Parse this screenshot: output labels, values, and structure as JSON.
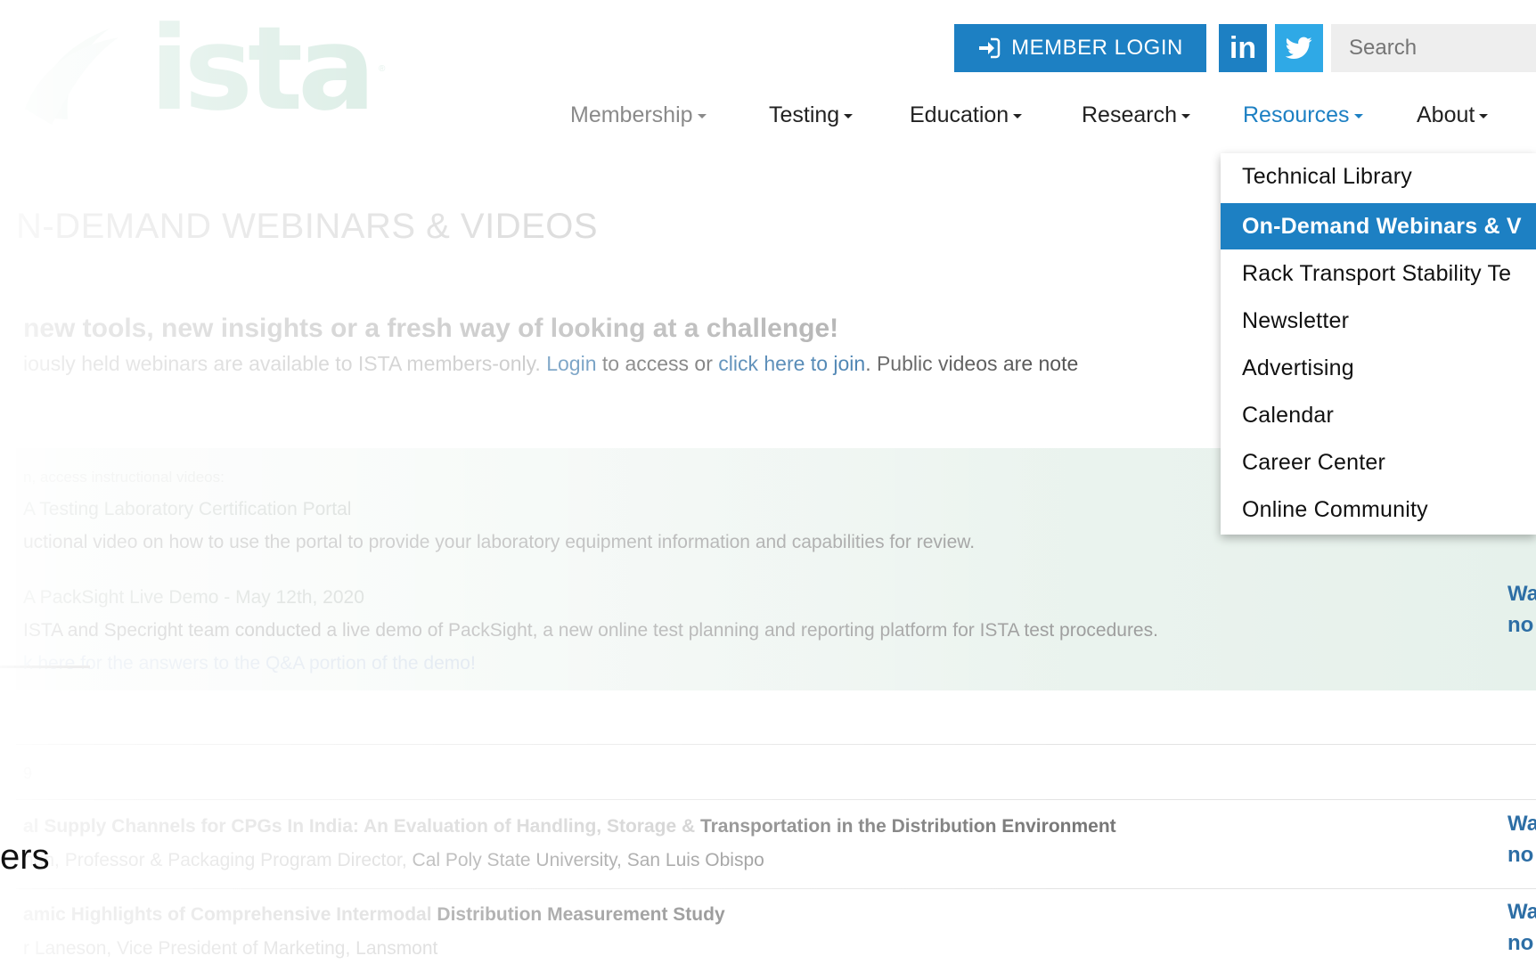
{
  "logo": {
    "text": "ista",
    "mark": "®"
  },
  "header": {
    "login_label": "MEMBER LOGIN",
    "login_icon": "sign-in-icon",
    "linkedin_label": "in",
    "twitter_icon": "twitter-bird-icon",
    "search_placeholder": "Search"
  },
  "nav": {
    "items": [
      {
        "label": "Membership"
      },
      {
        "label": "Testing"
      },
      {
        "label": "Education"
      },
      {
        "label": "Research"
      },
      {
        "label": "Resources"
      },
      {
        "label": "About"
      }
    ]
  },
  "dropdown": {
    "items": [
      {
        "label": "Technical Library"
      },
      {
        "label": "On-Demand Webinars & V"
      },
      {
        "label": "Rack Transport Stability Te"
      },
      {
        "label": "Newsletter"
      },
      {
        "label": "Advertising"
      },
      {
        "label": "Calendar"
      },
      {
        "label": "Career Center"
      },
      {
        "label": "Online Community"
      }
    ]
  },
  "page": {
    "title": "N-DEMAND WEBINARS & VIDEOS",
    "tagline": "new tools, new insights or a fresh way of looking at a challenge!",
    "intro_pre": "iously held webinars are available to ISTA members-only. ",
    "intro_login": "Login",
    "intro_mid": " to access or ",
    "intro_join": "click here to join",
    "intro_post": ". Public videos are note"
  },
  "instructional": {
    "label": "n, access instructional videos:",
    "items": [
      {
        "title": "A Testing Laboratory Certification Portal",
        "desc": "uctional video on how to use the portal to provide your laboratory equipment information and capabilities for review."
      },
      {
        "title": "A PackSight Live Demo - May 12th, 2020",
        "desc": "ISTA and Specright team conducted a live demo of PackSight, a new online test planning and reporting platform for ISTA test procedures.",
        "link": "k here for the answers to the Q&A portion of the demo!",
        "right_line1": "Wa",
        "right_line2": "no"
      }
    ]
  },
  "webinars": {
    "section_mark": "9",
    "items": [
      {
        "title_faded": "al Supply Channels for CPGs In India: An Evaluation of Handling, Storage & ",
        "title_dark": "Transportation in the Distribution Environment",
        "sub_faded": "ngh, Professor & Packaging Program Director, ",
        "sub_dark": "Cal Poly State University, San Luis Obispo",
        "right_line1": "Wa",
        "right_line2": "no"
      },
      {
        "title_faded": "amic Highlights of Comprehensive Intermodal ",
        "title_dark": "Distribution Measurement Study",
        "sub_faded": "r Laneson, Vice President of Marketing, Lansmont",
        "sub_dark": "",
        "right_line1": "Wa",
        "right_line2": "no"
      }
    ]
  },
  "overlay_text": "ers"
}
